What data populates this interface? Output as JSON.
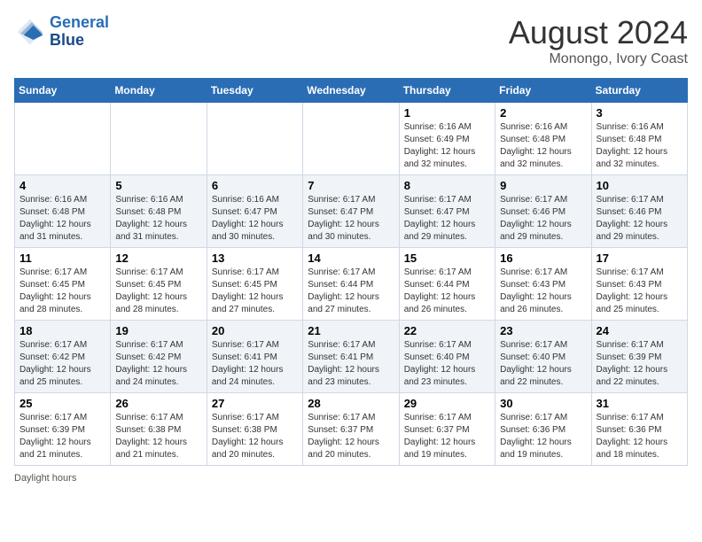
{
  "header": {
    "logo_line1": "General",
    "logo_line2": "Blue",
    "title": "August 2024",
    "subtitle": "Monongo, Ivory Coast"
  },
  "days_of_week": [
    "Sunday",
    "Monday",
    "Tuesday",
    "Wednesday",
    "Thursday",
    "Friday",
    "Saturday"
  ],
  "weeks": [
    [
      {
        "day": "",
        "info": ""
      },
      {
        "day": "",
        "info": ""
      },
      {
        "day": "",
        "info": ""
      },
      {
        "day": "",
        "info": ""
      },
      {
        "day": "1",
        "info": "Sunrise: 6:16 AM\nSunset: 6:49 PM\nDaylight: 12 hours\nand 32 minutes."
      },
      {
        "day": "2",
        "info": "Sunrise: 6:16 AM\nSunset: 6:48 PM\nDaylight: 12 hours\nand 32 minutes."
      },
      {
        "day": "3",
        "info": "Sunrise: 6:16 AM\nSunset: 6:48 PM\nDaylight: 12 hours\nand 32 minutes."
      }
    ],
    [
      {
        "day": "4",
        "info": "Sunrise: 6:16 AM\nSunset: 6:48 PM\nDaylight: 12 hours\nand 31 minutes."
      },
      {
        "day": "5",
        "info": "Sunrise: 6:16 AM\nSunset: 6:48 PM\nDaylight: 12 hours\nand 31 minutes."
      },
      {
        "day": "6",
        "info": "Sunrise: 6:16 AM\nSunset: 6:47 PM\nDaylight: 12 hours\nand 30 minutes."
      },
      {
        "day": "7",
        "info": "Sunrise: 6:17 AM\nSunset: 6:47 PM\nDaylight: 12 hours\nand 30 minutes."
      },
      {
        "day": "8",
        "info": "Sunrise: 6:17 AM\nSunset: 6:47 PM\nDaylight: 12 hours\nand 29 minutes."
      },
      {
        "day": "9",
        "info": "Sunrise: 6:17 AM\nSunset: 6:46 PM\nDaylight: 12 hours\nand 29 minutes."
      },
      {
        "day": "10",
        "info": "Sunrise: 6:17 AM\nSunset: 6:46 PM\nDaylight: 12 hours\nand 29 minutes."
      }
    ],
    [
      {
        "day": "11",
        "info": "Sunrise: 6:17 AM\nSunset: 6:45 PM\nDaylight: 12 hours\nand 28 minutes."
      },
      {
        "day": "12",
        "info": "Sunrise: 6:17 AM\nSunset: 6:45 PM\nDaylight: 12 hours\nand 28 minutes."
      },
      {
        "day": "13",
        "info": "Sunrise: 6:17 AM\nSunset: 6:45 PM\nDaylight: 12 hours\nand 27 minutes."
      },
      {
        "day": "14",
        "info": "Sunrise: 6:17 AM\nSunset: 6:44 PM\nDaylight: 12 hours\nand 27 minutes."
      },
      {
        "day": "15",
        "info": "Sunrise: 6:17 AM\nSunset: 6:44 PM\nDaylight: 12 hours\nand 26 minutes."
      },
      {
        "day": "16",
        "info": "Sunrise: 6:17 AM\nSunset: 6:43 PM\nDaylight: 12 hours\nand 26 minutes."
      },
      {
        "day": "17",
        "info": "Sunrise: 6:17 AM\nSunset: 6:43 PM\nDaylight: 12 hours\nand 25 minutes."
      }
    ],
    [
      {
        "day": "18",
        "info": "Sunrise: 6:17 AM\nSunset: 6:42 PM\nDaylight: 12 hours\nand 25 minutes."
      },
      {
        "day": "19",
        "info": "Sunrise: 6:17 AM\nSunset: 6:42 PM\nDaylight: 12 hours\nand 24 minutes."
      },
      {
        "day": "20",
        "info": "Sunrise: 6:17 AM\nSunset: 6:41 PM\nDaylight: 12 hours\nand 24 minutes."
      },
      {
        "day": "21",
        "info": "Sunrise: 6:17 AM\nSunset: 6:41 PM\nDaylight: 12 hours\nand 23 minutes."
      },
      {
        "day": "22",
        "info": "Sunrise: 6:17 AM\nSunset: 6:40 PM\nDaylight: 12 hours\nand 23 minutes."
      },
      {
        "day": "23",
        "info": "Sunrise: 6:17 AM\nSunset: 6:40 PM\nDaylight: 12 hours\nand 22 minutes."
      },
      {
        "day": "24",
        "info": "Sunrise: 6:17 AM\nSunset: 6:39 PM\nDaylight: 12 hours\nand 22 minutes."
      }
    ],
    [
      {
        "day": "25",
        "info": "Sunrise: 6:17 AM\nSunset: 6:39 PM\nDaylight: 12 hours\nand 21 minutes."
      },
      {
        "day": "26",
        "info": "Sunrise: 6:17 AM\nSunset: 6:38 PM\nDaylight: 12 hours\nand 21 minutes."
      },
      {
        "day": "27",
        "info": "Sunrise: 6:17 AM\nSunset: 6:38 PM\nDaylight: 12 hours\nand 20 minutes."
      },
      {
        "day": "28",
        "info": "Sunrise: 6:17 AM\nSunset: 6:37 PM\nDaylight: 12 hours\nand 20 minutes."
      },
      {
        "day": "29",
        "info": "Sunrise: 6:17 AM\nSunset: 6:37 PM\nDaylight: 12 hours\nand 19 minutes."
      },
      {
        "day": "30",
        "info": "Sunrise: 6:17 AM\nSunset: 6:36 PM\nDaylight: 12 hours\nand 19 minutes."
      },
      {
        "day": "31",
        "info": "Sunrise: 6:17 AM\nSunset: 6:36 PM\nDaylight: 12 hours\nand 18 minutes."
      }
    ]
  ],
  "footer": "Daylight hours"
}
